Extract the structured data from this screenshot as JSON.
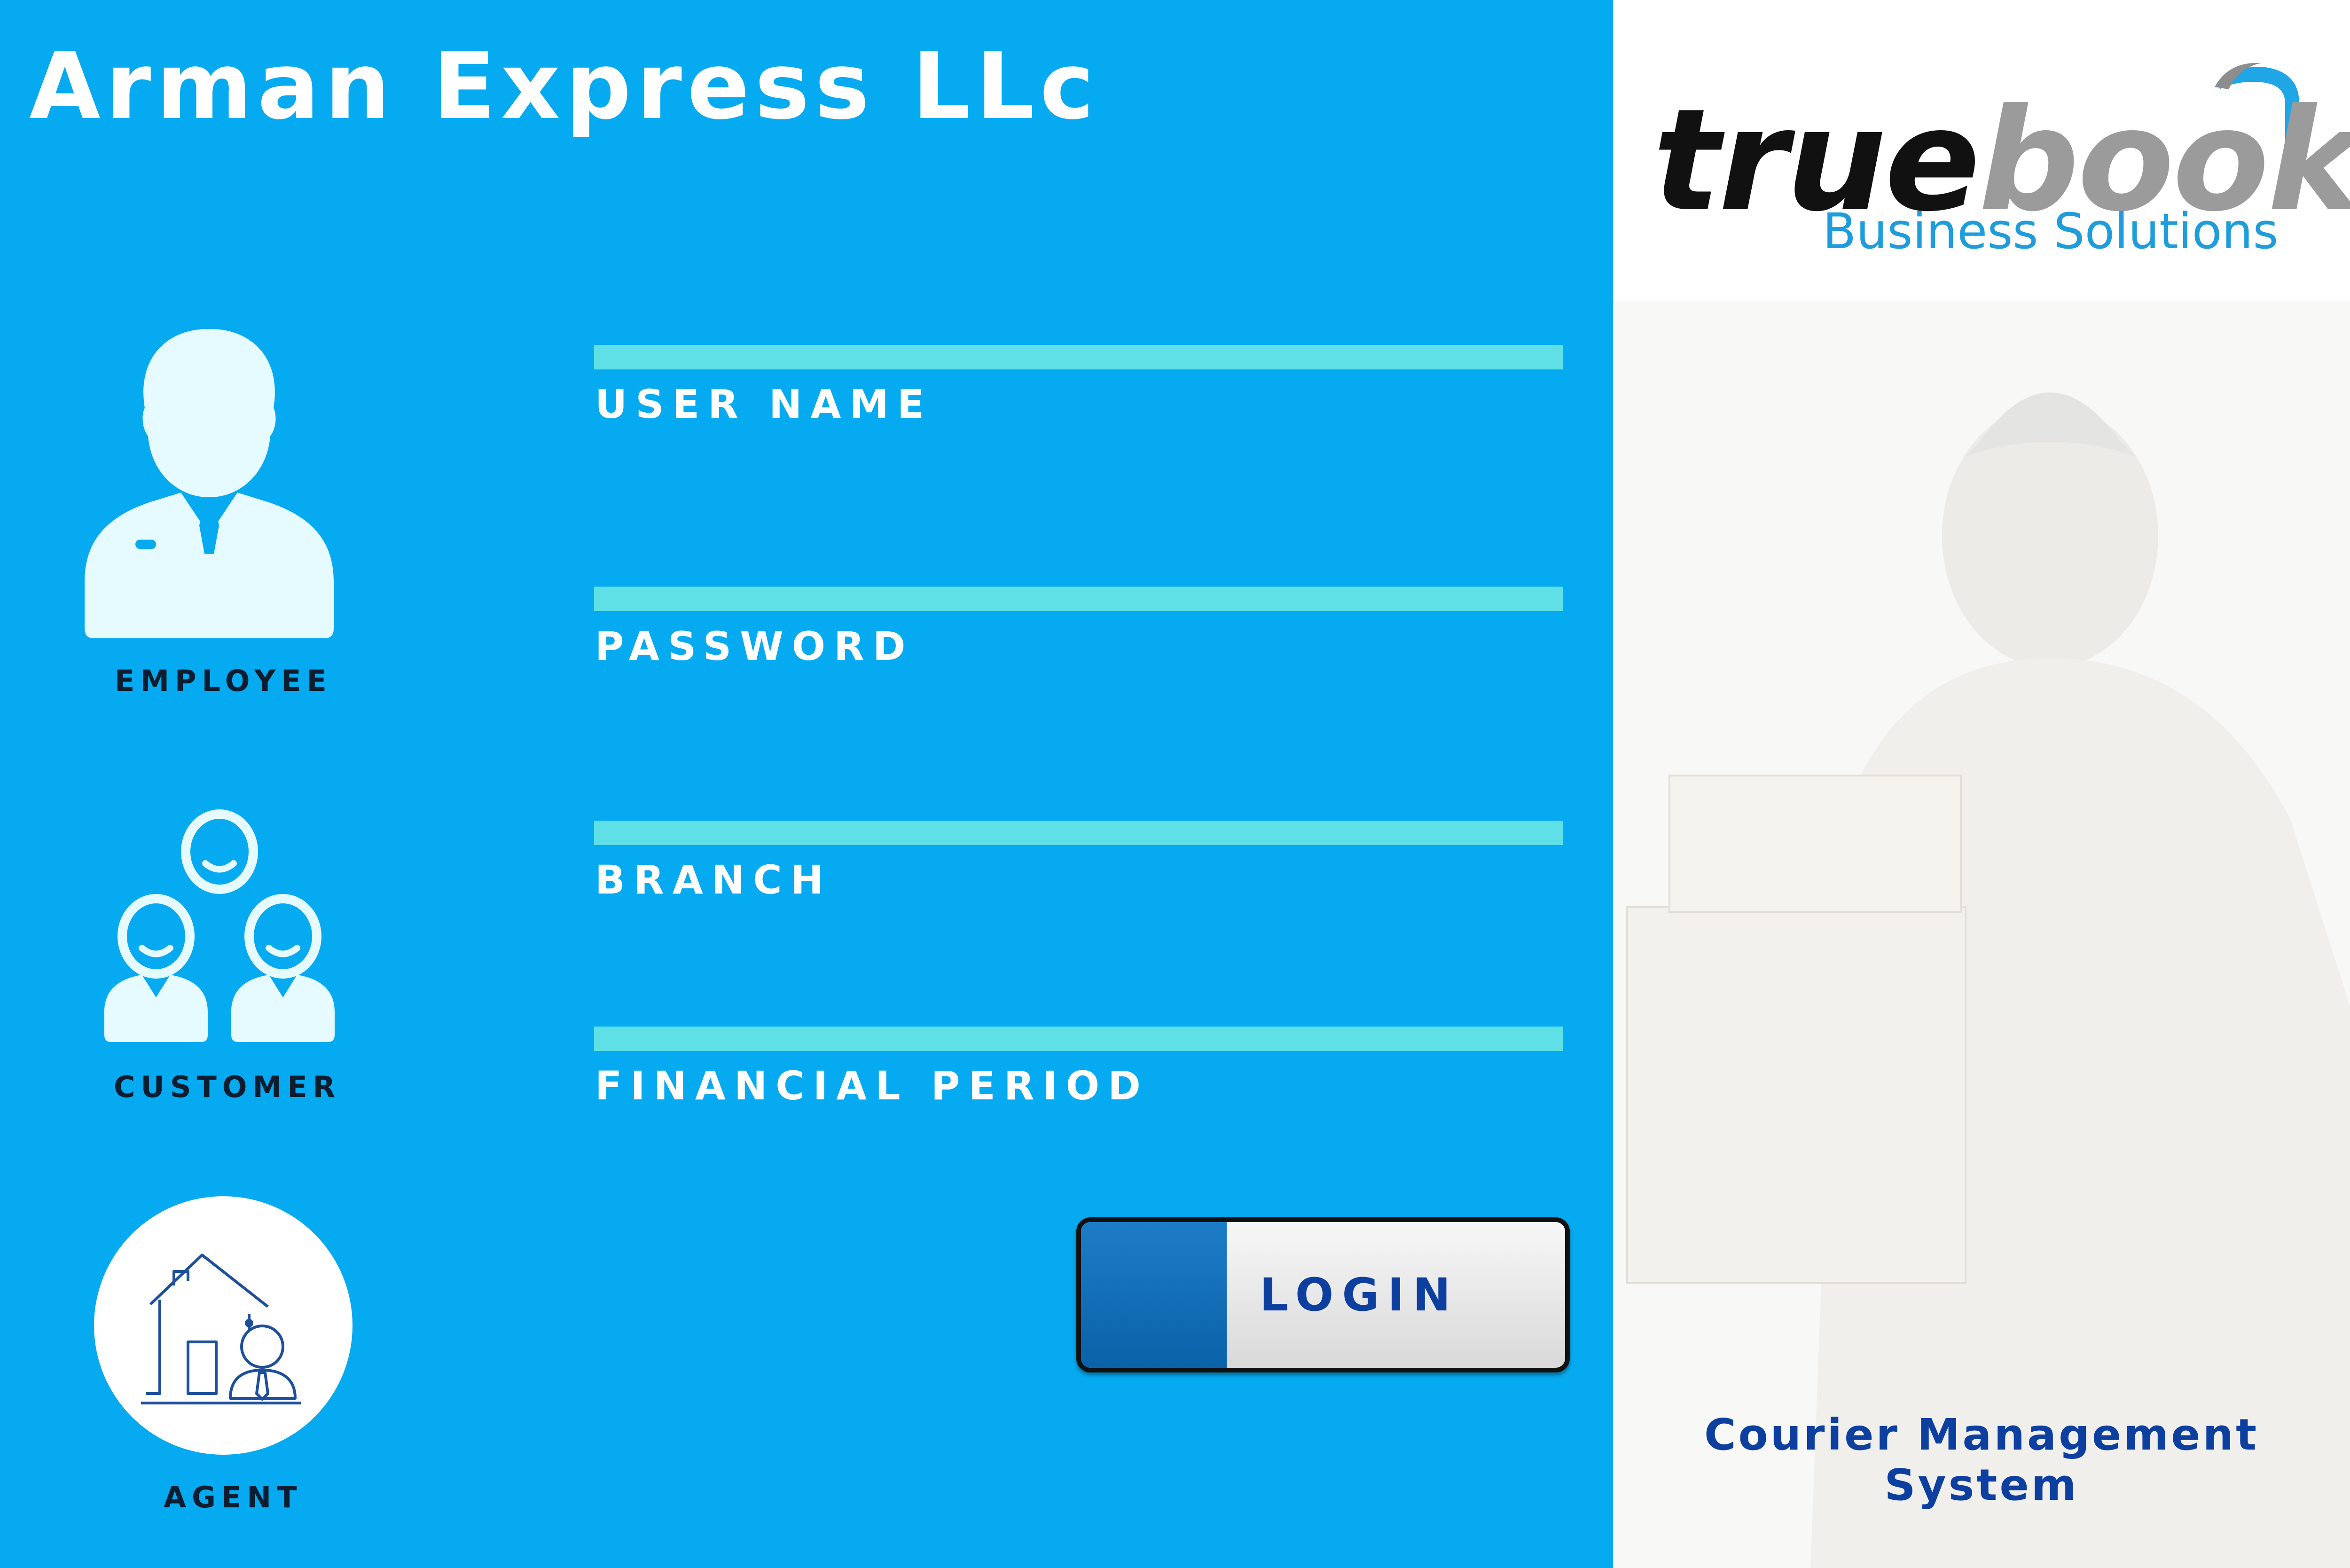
{
  "app": {
    "company_name": "Arman Express LLc"
  },
  "roles": [
    {
      "label": "EMPLOYEE",
      "icon": "employee-icon"
    },
    {
      "label": "CUSTOMER",
      "icon": "customers-group-icon"
    },
    {
      "label": "AGENT",
      "icon": "agent-house-icon"
    }
  ],
  "form": {
    "fields": [
      {
        "label": "USER NAME",
        "value": ""
      },
      {
        "label": "PASSWORD",
        "value": ""
      },
      {
        "label": "BRANCH",
        "value": ""
      },
      {
        "label": "FINANCIAL PERIOD",
        "value": ""
      }
    ],
    "login_label": "LOGIN"
  },
  "brand": {
    "word_dark": "true",
    "word_gray": "book",
    "tagline": "Business Solutions",
    "system_name_line1": "Courier Management",
    "system_name_line2": "System"
  },
  "colors": {
    "panel_blue": "#06aaf0",
    "field_bar": "#5fe0e6",
    "login_text": "#0d3fa0",
    "brand_blue": "#1e9cdb"
  }
}
